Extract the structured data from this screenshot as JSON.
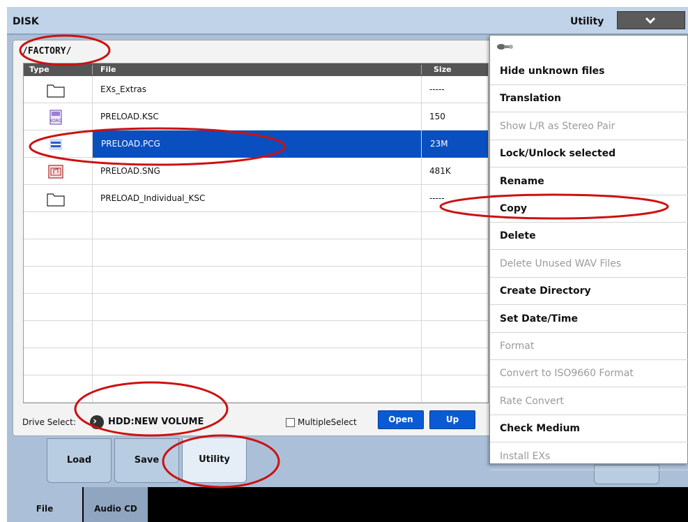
{
  "window": {
    "title": "DISK",
    "utility_label": "Utility",
    "utility_dropdown_icon": "chevron-down-icon"
  },
  "path": "/FACTORY/",
  "table": {
    "headers": {
      "type": "Type",
      "file": "File",
      "size": "Size"
    },
    "rows": [
      {
        "icon": "folder-icon",
        "file": "EXs_Extras",
        "size": "-----",
        "selected": false
      },
      {
        "icon": "korg-ksc-file-icon",
        "file": "PRELOAD.KSC",
        "size": "150",
        "selected": false
      },
      {
        "icon": "pcg-file-icon",
        "file": "PRELOAD.PCG",
        "size": "23M",
        "selected": true
      },
      {
        "icon": "song-file-icon",
        "file": "PRELOAD.SNG",
        "size": "481K",
        "selected": false
      },
      {
        "icon": "folder-icon",
        "file": "PRELOAD_Individual_KSC",
        "size": "-----",
        "selected": false
      }
    ],
    "empty_rows": 7
  },
  "drive": {
    "label": "Drive Select:",
    "value": "HDD:NEW VOLUME"
  },
  "multiple_select": {
    "label": "MultipleSelect",
    "checked": false
  },
  "buttons": {
    "open": "Open",
    "up": "Up"
  },
  "tabs": [
    {
      "label": "Load",
      "active": false
    },
    {
      "label": "Save",
      "active": false
    },
    {
      "label": "Utility",
      "active": true
    }
  ],
  "footer_tabs": [
    {
      "label": "File",
      "active": true
    },
    {
      "label": "Audio CD",
      "active": false
    }
  ],
  "menu": {
    "icon": "pin-icon",
    "items": [
      {
        "label": "Hide unknown files",
        "enabled": true
      },
      {
        "label": "Translation",
        "enabled": true
      },
      {
        "label": "Show L/R as Stereo Pair",
        "enabled": false
      },
      {
        "label": "Lock/Unlock selected",
        "enabled": true
      },
      {
        "label": "Rename",
        "enabled": true
      },
      {
        "label": "Copy",
        "enabled": true
      },
      {
        "label": "Delete",
        "enabled": true
      },
      {
        "label": "Delete Unused WAV Files",
        "enabled": false
      },
      {
        "label": "Create Directory",
        "enabled": true
      },
      {
        "label": "Set Date/Time",
        "enabled": true
      },
      {
        "label": "Format",
        "enabled": false
      },
      {
        "label": "Convert to ISO9660 Format",
        "enabled": false
      },
      {
        "label": "Rate Convert",
        "enabled": false
      },
      {
        "label": "Check Medium",
        "enabled": true
      },
      {
        "label": "Install EXs",
        "enabled": false
      }
    ]
  },
  "colors": {
    "background": "#abc0d8",
    "selection": "#0a4fc0",
    "button": "#0a5bd3",
    "annotation": "#cc1111"
  }
}
